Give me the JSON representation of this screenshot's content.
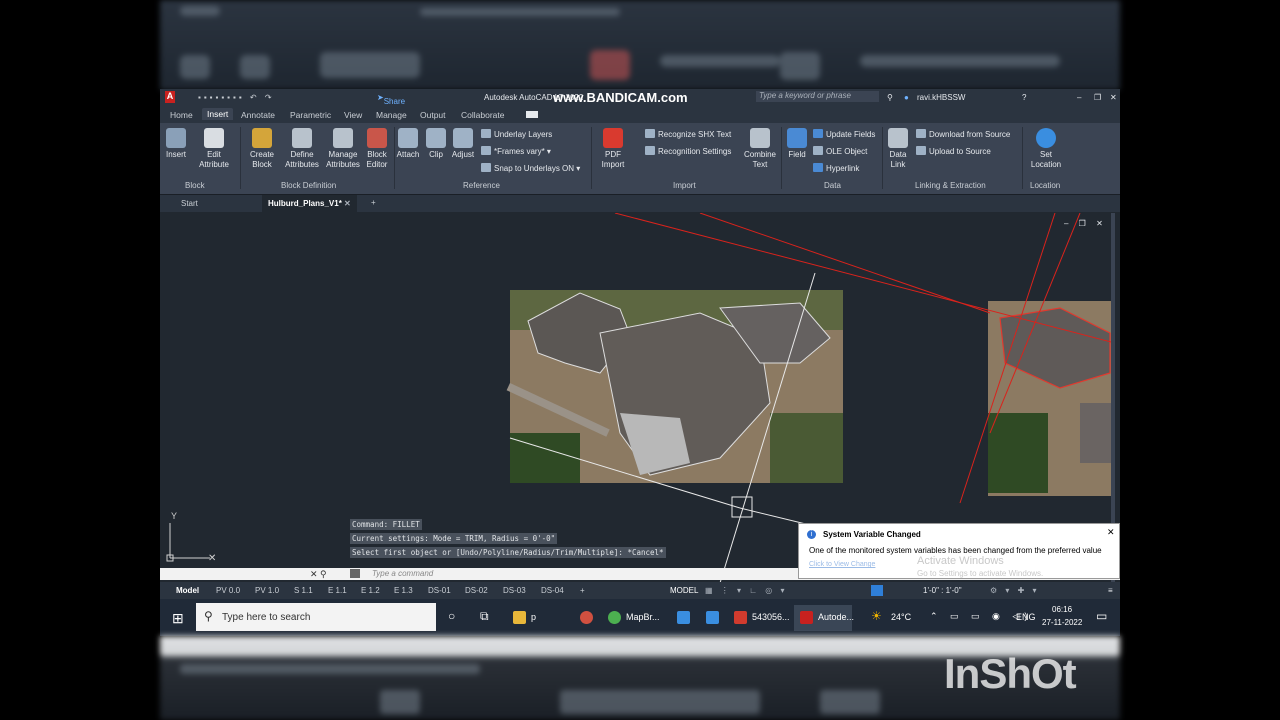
{
  "window": {
    "title": "Autodesk AutoCAD LT 2022",
    "watermark": "www.BANDICAM.com",
    "share_label": "Share",
    "search_placeholder": "Type a keyword or phrase",
    "user": "ravi.kHBSSW"
  },
  "ribbon_tabs": [
    "Home",
    "Insert",
    "Annotate",
    "Parametric",
    "View",
    "Manage",
    "Output",
    "Collaborate"
  ],
  "ribbon": {
    "insert": "Insert",
    "edit_attribute": [
      "Edit",
      "Attribute"
    ],
    "create_block": [
      "Create",
      "Block"
    ],
    "define_attributes": [
      "Define",
      "Attributes"
    ],
    "manage_attributes": [
      "Manage",
      "Attributes"
    ],
    "block_editor": [
      "Block",
      "Editor"
    ],
    "attach": "Attach",
    "clip": "Clip",
    "adjust": "Adjust",
    "underlay_layers": "Underlay Layers",
    "frames_vary": "*Frames vary*",
    "snap_underlays": "Snap to Underlays ON",
    "pdf_import": [
      "PDF",
      "Import"
    ],
    "recognize_shx": "Recognize SHX Text",
    "recognition_settings": "Recognition Settings",
    "combine_text": [
      "Combine",
      "Text"
    ],
    "field": "Field",
    "update_fields": "Update Fields",
    "ole_object": "OLE Object",
    "hyperlink": "Hyperlink",
    "data_link": [
      "Data",
      "Link"
    ],
    "download_source": "Download from Source",
    "upload_source": "Upload to Source",
    "set_location": [
      "Set",
      "Location"
    ],
    "panels": [
      "Block",
      "Block Definition",
      "Reference",
      "Import",
      "Data",
      "Linking & Extraction",
      "Location"
    ]
  },
  "doc_tabs": {
    "start": "Start",
    "active": "Hulburd_Plans_V1*"
  },
  "command": {
    "line1": "Command:  FILLET",
    "line2": "Current settings: Mode = TRIM, Radius = 0'-0\"",
    "line3": "Select first object or [Undo/Polyline/Radius/Trim/Multiple]: *Cancel*",
    "placeholder": "Type  a  command"
  },
  "layout_tabs": [
    "Model",
    "PV 0.0",
    "PV 1.0",
    "S 1.1",
    "E 1.1",
    "E 1.2",
    "E 1.3",
    "DS-01",
    "DS-02",
    "DS-03",
    "DS-04"
  ],
  "status": {
    "model": "MODEL",
    "scale": "1'-0\" : 1'-0\""
  },
  "notification": {
    "title": "System Variable Changed",
    "body": "One of the monitored system variables has been changed from the preferred value",
    "link": "Click to View Change",
    "activate1": "Activate Windows",
    "activate2": "Go to Settings to activate Windows."
  },
  "taskbar": {
    "search": "Type here to search",
    "folder": "p",
    "mapbr": "MapBr...",
    "num": "543056...",
    "autocad": "Autode...",
    "temp": "24°C",
    "lang": "ENG",
    "time": "06:16",
    "date": "27-11-2022"
  },
  "inshot": "InShOt",
  "colors": {
    "ribbon": "#3b4453",
    "canvas": "#212830",
    "accent": "#2f7fd8",
    "redline": "#d9231c"
  }
}
